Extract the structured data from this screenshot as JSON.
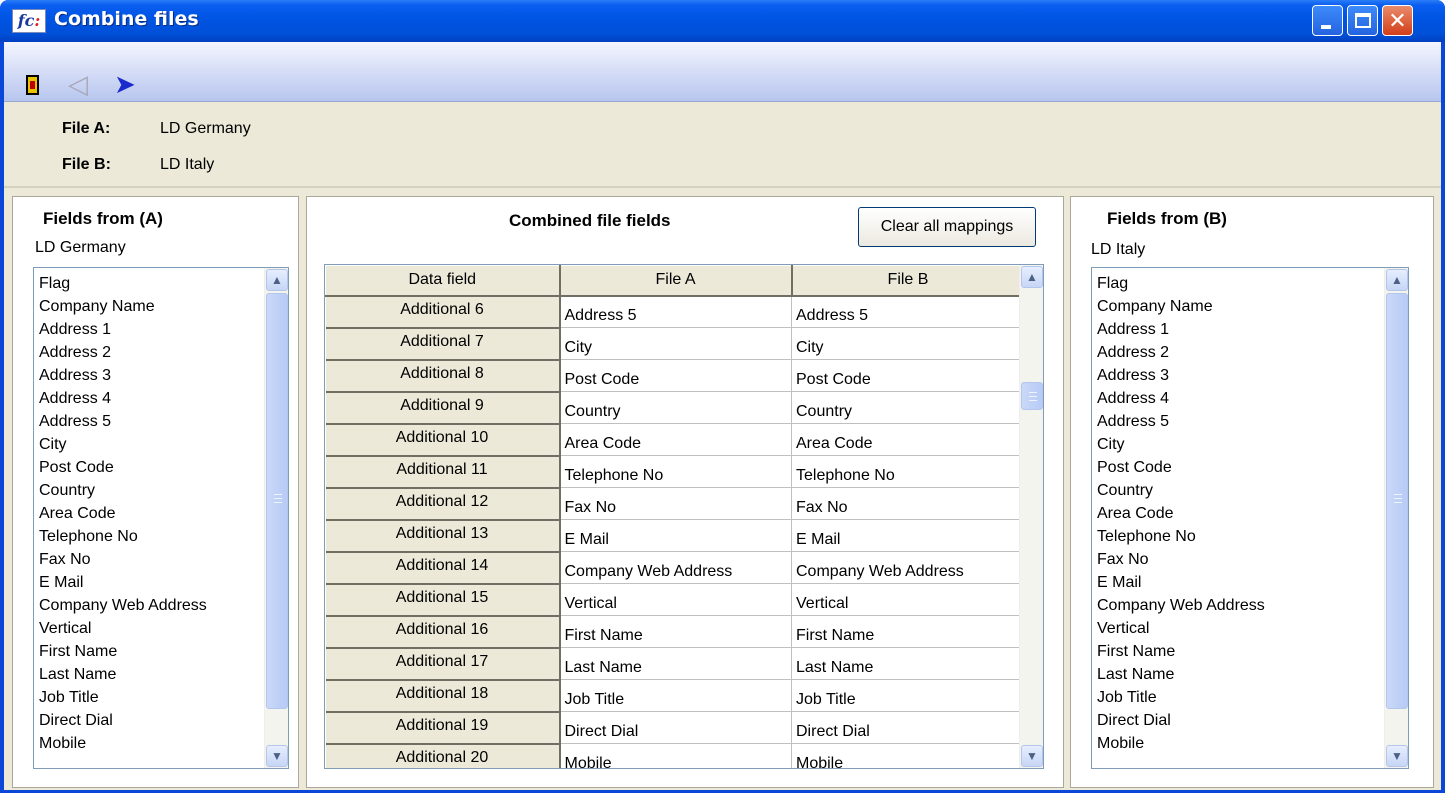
{
  "window": {
    "title": "Combine files",
    "logo_text": "fc",
    "logo_colon": ":"
  },
  "toolbar": {
    "exit_icon": "exit-door-icon",
    "back_icon": "back-arrow-icon",
    "forward_icon": "forward-arrow-icon",
    "back_glyph": "◁",
    "forward_glyph": "➤"
  },
  "file_info": {
    "a_label": "File A:",
    "a_value": "LD Germany",
    "b_label": "File B:",
    "b_value": "LD Italy"
  },
  "left_panel": {
    "title": "Fields from (A)",
    "subtitle": "LD Germany",
    "items": [
      "Flag",
      "Company Name",
      "Address 1",
      "Address 2",
      "Address 3",
      "Address 4",
      "Address 5",
      "City",
      "Post Code",
      "Country",
      "Area Code",
      "Telephone No",
      "Fax No",
      "E Mail",
      "Company Web Address",
      "Vertical",
      "First Name",
      "Last Name",
      "Job Title",
      "Direct Dial",
      "Mobile"
    ]
  },
  "right_panel": {
    "title": "Fields from (B)",
    "subtitle": "LD Italy",
    "items": [
      "Flag",
      "Company Name",
      "Address 1",
      "Address 2",
      "Address 3",
      "Address 4",
      "Address 5",
      "City",
      "Post Code",
      "Country",
      "Area Code",
      "Telephone No",
      "Fax No",
      "E Mail",
      "Company Web Address",
      "Vertical",
      "First Name",
      "Last Name",
      "Job Title",
      "Direct Dial",
      "Mobile"
    ]
  },
  "middle_panel": {
    "title": "Combined file fields",
    "clear_button": "Clear all mappings",
    "columns": [
      "Data field",
      "File A",
      "File B"
    ],
    "rows": [
      [
        "Additional 6",
        "Address 5",
        "Address 5"
      ],
      [
        "Additional 7",
        "City",
        "City"
      ],
      [
        "Additional 8",
        "Post Code",
        "Post Code"
      ],
      [
        "Additional 9",
        "Country",
        "Country"
      ],
      [
        "Additional 10",
        "Area Code",
        "Area Code"
      ],
      [
        "Additional 11",
        "Telephone No",
        "Telephone No"
      ],
      [
        "Additional 12",
        "Fax No",
        "Fax No"
      ],
      [
        "Additional 13",
        "E Mail",
        "E Mail"
      ],
      [
        "Additional 14",
        "Company Web Address",
        "Company Web Address"
      ],
      [
        "Additional 15",
        "Vertical",
        "Vertical"
      ],
      [
        "Additional 16",
        "First Name",
        "First Name"
      ],
      [
        "Additional 17",
        "Last Name",
        "Last Name"
      ],
      [
        "Additional 18",
        "Job Title",
        "Job Title"
      ],
      [
        "Additional 19",
        "Direct Dial",
        "Direct Dial"
      ],
      [
        "Additional 20",
        "Mobile",
        "Mobile"
      ]
    ]
  },
  "colors": {
    "titlebar": "#0054e3",
    "face": "#ece9d8",
    "accent": "#1a2acc"
  }
}
